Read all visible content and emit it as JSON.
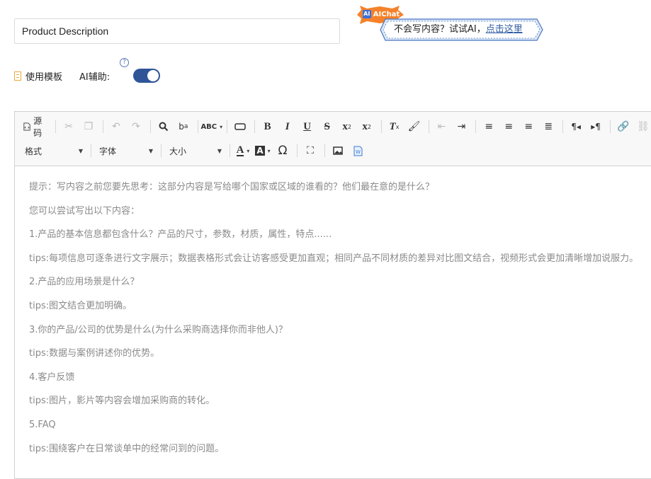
{
  "title_field": {
    "value": "Product Description"
  },
  "ai_promo": {
    "badge": "AIChat",
    "text": "不会写内容？试试AI，",
    "link": "点击这里"
  },
  "options": {
    "help": "?",
    "template_label": "使用模板",
    "ai_assist_label": "AI辅助:",
    "ai_assist_enabled": true
  },
  "toolbar": {
    "source_label": "源码",
    "format_label": "格式",
    "font_label": "字体",
    "size_label": "大小"
  },
  "content": {
    "lines": [
      "提示：写内容之前您要先思考：这部分内容是写给哪个国家或区域的谁看的？他们最在意的是什么？",
      "您可以尝试写出以下内容：",
      "1.产品的基本信息都包含什么？产品的尺寸，参数，材质，属性，特点......",
      "tips:每项信息可逐条进行文字展示；数据表格形式会让访客感受更加直观；相同产品不同材质的差异对比图文结合，视频形式会更加清晰增加说服力。",
      "2.产品的应用场景是什么？",
      "tips:图文结合更加明确。",
      "3.你的产品/公司的优势是什么(为什么采购商选择你而非他人)？",
      "tips:数据与案例讲述你的优势。",
      "4.客户反馈",
      "tips:图片，影片等内容会增加采购商的转化。",
      "5.FAQ",
      "tips:围绕客户在日常谈单中的经常问到的问题。"
    ]
  },
  "colors": {
    "toggle_on": "#2f5597",
    "promo_badge": "#f5822a",
    "link": "#2c5aa0",
    "placeholder_text": "#8a8a8a"
  }
}
